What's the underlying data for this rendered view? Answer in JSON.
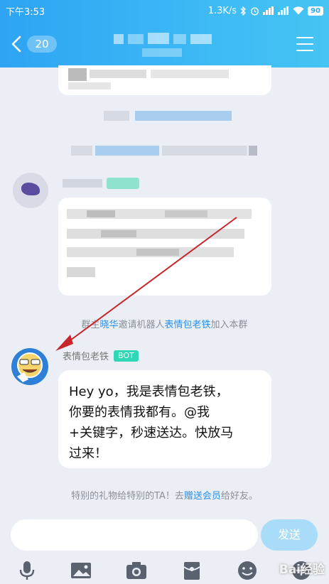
{
  "status_bar": {
    "time": "下午3:53",
    "network_speed": "1.3K/s",
    "battery": "90"
  },
  "nav": {
    "unread_count": "20"
  },
  "system_messages": {
    "invite_prefix": "群主",
    "inviter": "晓华",
    "invite_middle": "邀请机器人",
    "robot_name": "表情包老铁",
    "invite_suffix": "加入本群",
    "gift_prefix": "特别的礼物给特别的TA！去",
    "gift_link": "赠送会员",
    "gift_suffix": "给好友。"
  },
  "bot_message": {
    "sender": "表情包老铁",
    "tag": "BOT",
    "lines": [
      "Hey yo，我是表情包老铁，",
      "你要的表情我都有。@我",
      "+关键字，秒速送达。快放马",
      "过来！"
    ]
  },
  "composer": {
    "placeholder": "",
    "send_label": "发送"
  },
  "toolbar_icons": [
    "microphone-icon",
    "image-icon",
    "camera-icon",
    "red-packet-icon",
    "emoji-icon",
    "more-icon"
  ],
  "watermark": "Bai经验",
  "colors": {
    "header": "#3cb7f5",
    "bot_tag": "#2fd7b5",
    "link": "#2a8fe6",
    "arrow": "#c8262b"
  }
}
